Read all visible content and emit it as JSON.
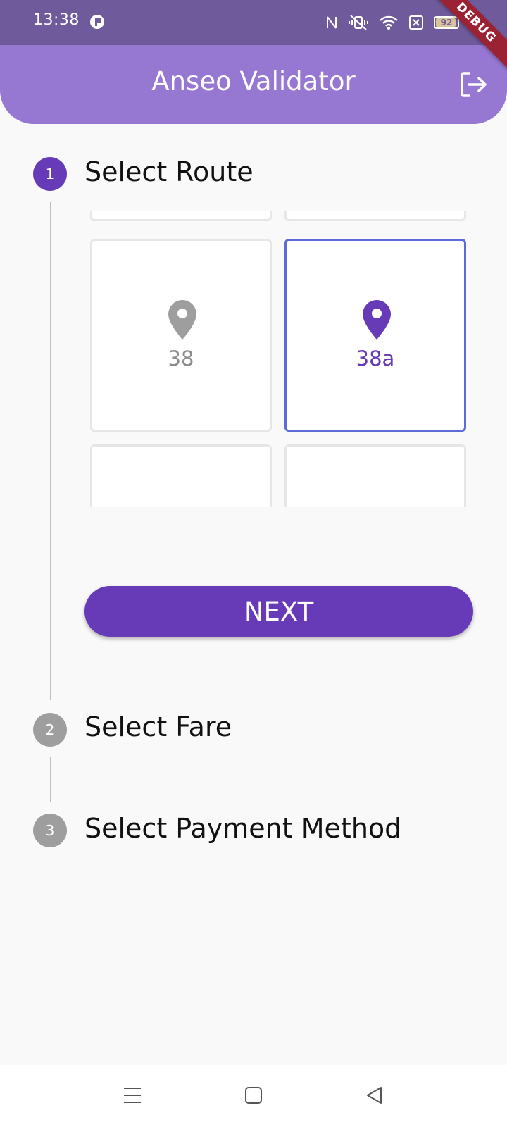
{
  "status_bar": {
    "time": "13:38",
    "battery": "92",
    "icons": [
      "app-icon",
      "nfc-icon",
      "vibrate-icon",
      "wifi-icon",
      "sim-icon",
      "battery-icon",
      "charging-icon"
    ]
  },
  "debug_banner": "DEBUG",
  "app_bar": {
    "title": "Anseo Validator",
    "action_icon": "logout-icon"
  },
  "stepper": {
    "steps": [
      {
        "number": "1",
        "title": "Select Route",
        "state": "active"
      },
      {
        "number": "2",
        "title": "Select Fare",
        "state": "inactive"
      },
      {
        "number": "3",
        "title": "Select Payment Method",
        "state": "inactive"
      }
    ],
    "routes": [
      {
        "label": "38",
        "selected": false
      },
      {
        "label": "38a",
        "selected": true
      }
    ],
    "next_label": "NEXT"
  },
  "colors": {
    "primary": "#673ab7",
    "app_bar": "#9677d1",
    "status_bar": "#6f5a9b",
    "selected_border": "#5c6bd6",
    "inactive": "#9e9e9e"
  },
  "nav_bar": {
    "icons": [
      "menu-icon",
      "home-icon",
      "back-icon"
    ]
  }
}
